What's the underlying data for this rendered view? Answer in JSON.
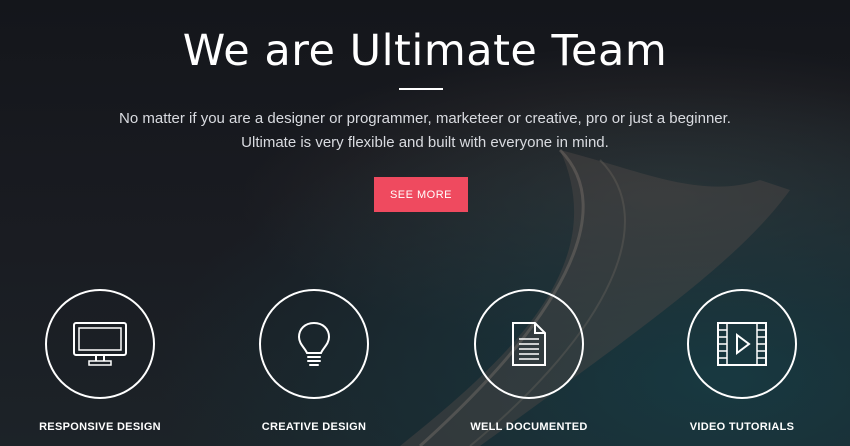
{
  "hero": {
    "title": "We are Ultimate Team",
    "subtitle_line1": "No matter if you are a designer or programmer, marketeer or creative, pro or just a beginner.",
    "subtitle_line2": "Ultimate is very flexible and built with everyone in mind.",
    "cta_label": "SEE MORE",
    "accent_color": "#ef4a5f"
  },
  "features": [
    {
      "icon": "monitor-icon",
      "label": "RESPONSIVE DESIGN"
    },
    {
      "icon": "lightbulb-icon",
      "label": "CREATIVE DESIGN"
    },
    {
      "icon": "document-icon",
      "label": "WELL DOCUMENTED"
    },
    {
      "icon": "video-icon",
      "label": "VIDEO TUTORIALS"
    }
  ]
}
